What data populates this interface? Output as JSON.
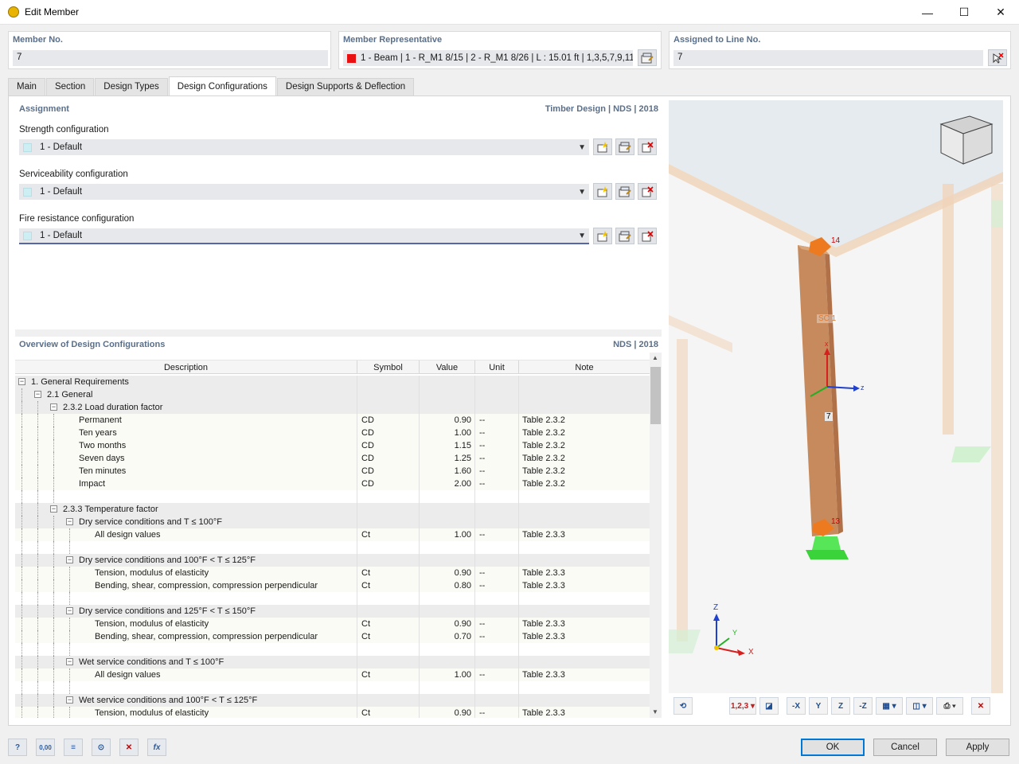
{
  "window": {
    "title": "Edit Member"
  },
  "header": {
    "member_no": {
      "label": "Member No.",
      "value": "7"
    },
    "member_rep": {
      "label": "Member Representative",
      "value": "1 - Beam | 1 - R_M1 8/15 | 2 - R_M1 8/26 | L : 15.01 ft | 1,3,5,7,9,11,...",
      "color": "#e81010"
    },
    "assigned_line": {
      "label": "Assigned to Line No.",
      "value": "7"
    }
  },
  "tabs": [
    "Main",
    "Section",
    "Design Types",
    "Design Configurations",
    "Design Supports & Deflection"
  ],
  "active_tab": "Design Configurations",
  "assignment": {
    "title": "Assignment",
    "standard": "Timber Design | NDS | 2018",
    "strength": {
      "label": "Strength configuration",
      "value": "1 - Default"
    },
    "serviceability": {
      "label": "Serviceability configuration",
      "value": "1 - Default"
    },
    "fire": {
      "label": "Fire resistance configuration",
      "value": "1 - Default"
    }
  },
  "overview": {
    "title": "Overview of Design Configurations",
    "standard": "NDS | 2018",
    "columns": [
      "Description",
      "Symbol",
      "Value",
      "Unit",
      "Note"
    ]
  },
  "rows": [
    {
      "level": 0,
      "type": "grp",
      "desc": "1. General Requirements",
      "sym": "",
      "val": "",
      "unit": "",
      "note": ""
    },
    {
      "level": 1,
      "type": "grp",
      "desc": "2.1 General",
      "sym": "",
      "val": "",
      "unit": "",
      "note": ""
    },
    {
      "level": 2,
      "type": "grp",
      "desc": "2.3.2 Load duration factor",
      "sym": "",
      "val": "",
      "unit": "",
      "note": ""
    },
    {
      "level": 3,
      "type": "item",
      "desc": "Permanent",
      "sym": "CD",
      "val": "0.90",
      "unit": "--",
      "note": "Table 2.3.2"
    },
    {
      "level": 3,
      "type": "item",
      "desc": "Ten years",
      "sym": "CD",
      "val": "1.00",
      "unit": "--",
      "note": "Table 2.3.2"
    },
    {
      "level": 3,
      "type": "item",
      "desc": "Two months",
      "sym": "CD",
      "val": "1.15",
      "unit": "--",
      "note": "Table 2.3.2"
    },
    {
      "level": 3,
      "type": "item",
      "desc": "Seven days",
      "sym": "CD",
      "val": "1.25",
      "unit": "--",
      "note": "Table 2.3.2"
    },
    {
      "level": 3,
      "type": "item",
      "desc": "Ten minutes",
      "sym": "CD",
      "val": "1.60",
      "unit": "--",
      "note": "Table 2.3.2"
    },
    {
      "level": 3,
      "type": "item",
      "desc": "Impact",
      "sym": "CD",
      "val": "2.00",
      "unit": "--",
      "note": "Table 2.3.2"
    },
    {
      "level": 3,
      "type": "blank",
      "desc": "",
      "sym": "",
      "val": "",
      "unit": "",
      "note": ""
    },
    {
      "level": 2,
      "type": "grp",
      "desc": "2.3.3 Temperature factor",
      "sym": "",
      "val": "",
      "unit": "",
      "note": ""
    },
    {
      "level": 3,
      "type": "grp",
      "desc": "Dry service conditions and T ≤ 100°F",
      "sym": "",
      "val": "",
      "unit": "",
      "note": ""
    },
    {
      "level": 4,
      "type": "item",
      "desc": "All design values",
      "sym": "Ct",
      "val": "1.00",
      "unit": "--",
      "note": "Table 2.3.3"
    },
    {
      "level": 4,
      "type": "blank",
      "desc": "",
      "sym": "",
      "val": "",
      "unit": "",
      "note": ""
    },
    {
      "level": 3,
      "type": "grp",
      "desc": "Dry service conditions and 100°F < T ≤ 125°F",
      "sym": "",
      "val": "",
      "unit": "",
      "note": ""
    },
    {
      "level": 4,
      "type": "item",
      "desc": "Tension, modulus of elasticity",
      "sym": "Ct",
      "val": "0.90",
      "unit": "--",
      "note": "Table 2.3.3"
    },
    {
      "level": 4,
      "type": "item",
      "desc": "Bending, shear, compression, compression perpendicular",
      "sym": "Ct",
      "val": "0.80",
      "unit": "--",
      "note": "Table 2.3.3"
    },
    {
      "level": 4,
      "type": "blank",
      "desc": "",
      "sym": "",
      "val": "",
      "unit": "",
      "note": ""
    },
    {
      "level": 3,
      "type": "grp",
      "desc": "Dry service conditions and 125°F < T ≤ 150°F",
      "sym": "",
      "val": "",
      "unit": "",
      "note": ""
    },
    {
      "level": 4,
      "type": "item",
      "desc": "Tension, modulus of elasticity",
      "sym": "Ct",
      "val": "0.90",
      "unit": "--",
      "note": "Table 2.3.3"
    },
    {
      "level": 4,
      "type": "item",
      "desc": "Bending, shear, compression, compression perpendicular",
      "sym": "Ct",
      "val": "0.70",
      "unit": "--",
      "note": "Table 2.3.3"
    },
    {
      "level": 4,
      "type": "blank",
      "desc": "",
      "sym": "",
      "val": "",
      "unit": "",
      "note": ""
    },
    {
      "level": 3,
      "type": "grp",
      "desc": "Wet service conditions and T ≤ 100°F",
      "sym": "",
      "val": "",
      "unit": "",
      "note": ""
    },
    {
      "level": 4,
      "type": "item",
      "desc": "All design values",
      "sym": "Ct",
      "val": "1.00",
      "unit": "--",
      "note": "Table 2.3.3"
    },
    {
      "level": 4,
      "type": "blank",
      "desc": "",
      "sym": "",
      "val": "",
      "unit": "",
      "note": ""
    },
    {
      "level": 3,
      "type": "grp",
      "desc": "Wet service conditions and 100°F < T ≤ 125°F",
      "sym": "",
      "val": "",
      "unit": "",
      "note": ""
    },
    {
      "level": 4,
      "type": "item",
      "desc": "Tension, modulus of elasticity",
      "sym": "Ct",
      "val": "0.90",
      "unit": "--",
      "note": "Table 2.3.3"
    }
  ],
  "view3d": {
    "node_top": "14",
    "node_bottom": "13",
    "support_label": "SC 1",
    "member_label": "7",
    "axis_x": "x",
    "axis_z": "z",
    "axis_X": "X",
    "axis_Y": "Y",
    "axis_Z": "Z"
  },
  "buttons": {
    "ok": "OK",
    "cancel": "Cancel",
    "apply": "Apply"
  }
}
